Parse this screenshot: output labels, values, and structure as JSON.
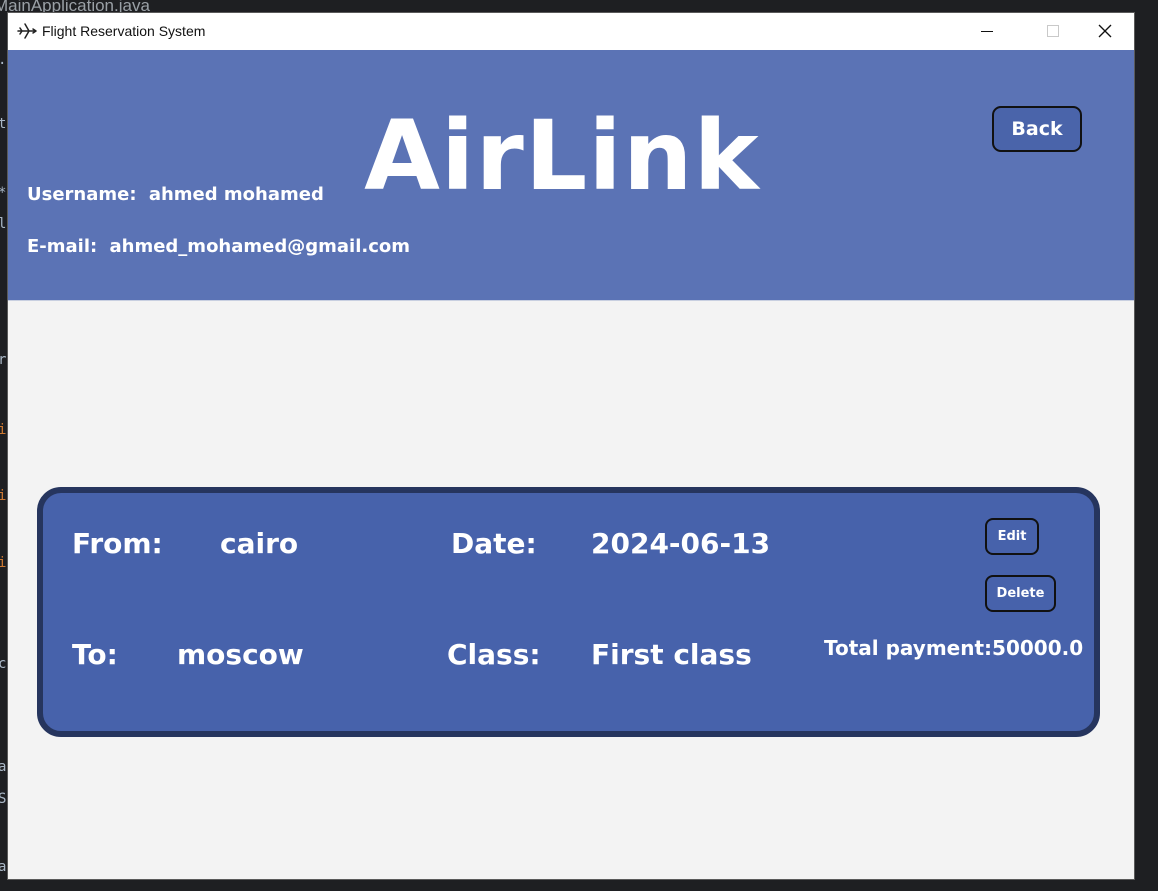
{
  "background": {
    "tab_text": "MainApplication.java",
    "code_fragments": [
      ".",
      "t",
      "*",
      "l",
      "r",
      "i",
      "i",
      "i",
      "c",
      "a",
      "S",
      "a"
    ]
  },
  "window": {
    "title": "Flight Reservation System",
    "icon": "airplane-icon",
    "controls": [
      "minimize-icon",
      "maximize-icon",
      "close-icon"
    ]
  },
  "header": {
    "logo": "AirLink",
    "username_label": "Username:",
    "username_value": "ahmed mohamed",
    "email_label": "E-mail:",
    "email_value": "ahmed_mohamed@gmail.com",
    "back_label": "Back",
    "bg_color": "#5b73b5"
  },
  "reservation": {
    "from_label": "From:",
    "from_value": "cairo",
    "to_label": "To:",
    "to_value": "moscow",
    "date_label": "Date:",
    "date_value": "2024-06-13",
    "class_label": "Class:",
    "class_value": "First class",
    "edit_label": "Edit",
    "delete_label": "Delete",
    "payment_label": "Total payment:",
    "payment_value": "50000.0",
    "card_color": "#4762ab",
    "border_color": "#26355e"
  }
}
